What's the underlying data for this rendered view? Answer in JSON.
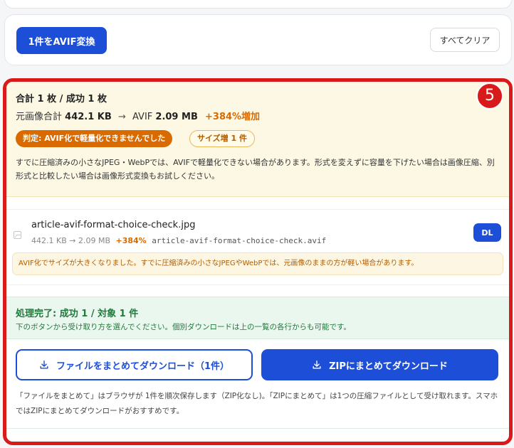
{
  "actions": {
    "convert_label": "1件をAVIF変換",
    "clear_label": "すべてクリア"
  },
  "step_badge": "5",
  "summary": {
    "title": "合計 1 枚 / 成功 1 枚",
    "original_label": "元画像合計",
    "original_size": "442.1 KB",
    "arrow": "→",
    "avif_label": "AVIF",
    "avif_size": "2.09 MB",
    "increase": "+384%増加",
    "verdict": "判定: AVIF化で軽量化できませんでした",
    "size_increase_badge": "サイズ増 1 件",
    "note": "すでに圧縮済みの小さなJPEG・WebPでは、AVIFで軽量化できない場合があります。形式を変えずに容量を下げたい場合は画像圧縮、別形式と比較したい場合は画像形式変換もお試しください。"
  },
  "file": {
    "name": "article-avif-format-choice-check.jpg",
    "original_size": "442.1 KB",
    "arrow": "→",
    "new_size": "2.09 MB",
    "change": "+384%",
    "output_name": "article-avif-format-choice-check.avif",
    "dl_label": "DL",
    "warning": "AVIF化でサイズが大きくなりました。すでに圧縮済みの小さなJPEGやWebPでは、元画像のままの方が軽い場合があります。"
  },
  "done": {
    "title": "処理完了: 成功 1 / 対象 1 件",
    "subtitle": "下のボタンから受け取り方を選んでください。個別ダウンロードは上の一覧の各行からも可能です。"
  },
  "downloads": {
    "bulk_label": "ファイルをまとめてダウンロード（1件）",
    "zip_label": "ZIPにまとめてダウンロード"
  },
  "bottom_note": "「ファイルをまとめて」はブラウザが 1件を順次保存します（ZIP化なし)。「ZIPにまとめて」は1つの圧縮ファイルとして受け取れます。スマホではZIPにまとめてダウンロードがおすすめです。",
  "colors": {
    "primary": "#1d4ed8",
    "highlight_border": "#d91a1a",
    "warning": "#d96a00",
    "success": "#1f7a3a",
    "summary_bg": "#fdf8e4"
  }
}
